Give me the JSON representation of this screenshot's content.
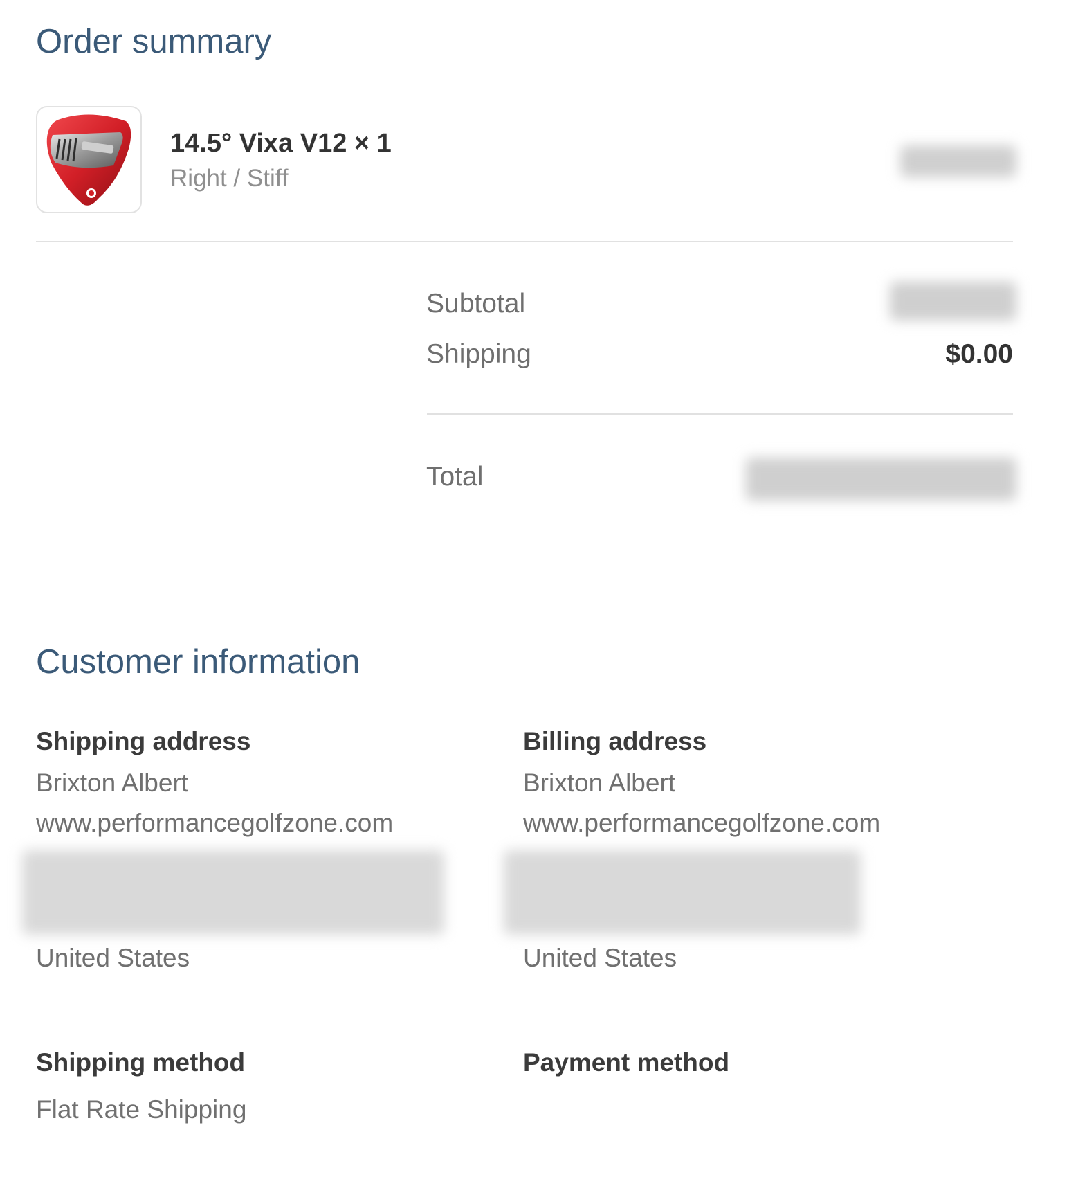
{
  "order_summary": {
    "title": "Order summary",
    "product": {
      "name": "14.5° Vixa V12 × 1",
      "variant": "Right / Stiff",
      "image_icon": "golf-club-head-icon",
      "accent_color": "#d8232a"
    },
    "totals": {
      "subtotal_label": "Subtotal",
      "shipping_label": "Shipping",
      "shipping_value": "$0.00",
      "total_label": "Total"
    }
  },
  "customer_information": {
    "title": "Customer information",
    "shipping_address": {
      "heading": "Shipping address",
      "name": "Brixton Albert",
      "company": "www.performancegolfzone.com",
      "country": "United States"
    },
    "billing_address": {
      "heading": "Billing address",
      "name": "Brixton Albert",
      "company": "www.performancegolfzone.com",
      "country": "United States"
    },
    "shipping_method": {
      "heading": "Shipping method",
      "value": "Flat Rate Shipping"
    },
    "payment_method": {
      "heading": "Payment method"
    }
  },
  "colors": {
    "heading": "#3b5a78",
    "divider": "#e1e1e1",
    "muted_text": "#707070"
  }
}
